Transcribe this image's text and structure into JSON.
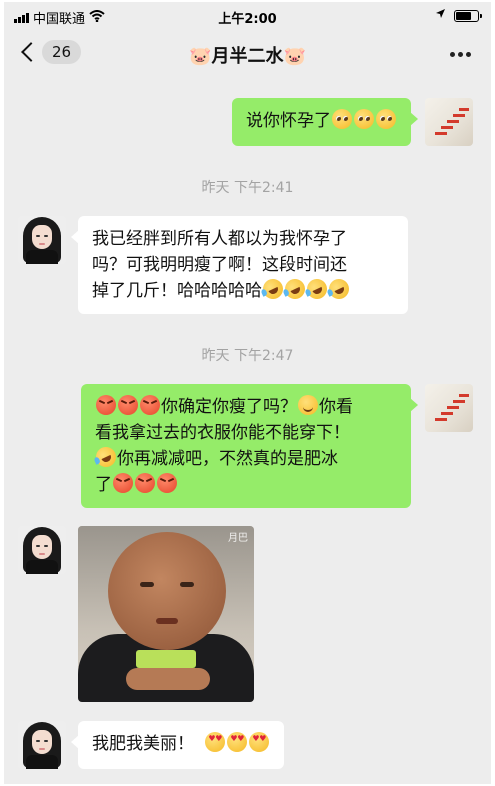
{
  "status_bar": {
    "carrier": "中国联通",
    "time": "上午2:00"
  },
  "nav": {
    "back_count": "26",
    "title": "🐷月半二水🐷"
  },
  "messages": [
    {
      "type": "outgoing",
      "text": "说你怀孕了",
      "emoji": [
        "pleading-face",
        "pleading-face",
        "pleading-face"
      ]
    },
    {
      "type": "timestamp",
      "text": "昨天 下午2:41"
    },
    {
      "type": "incoming",
      "lines": [
        "我已经胖到所有人都以为我怀孕了",
        "吗？可我明明瘦了啊！这段时间还",
        "掉了几斤！哈哈哈哈哈"
      ],
      "emoji": [
        "rolling-laughing",
        "rolling-laughing",
        "rolling-laughing",
        "rolling-laughing"
      ]
    },
    {
      "type": "timestamp",
      "text": "昨天 下午2:47"
    },
    {
      "type": "outgoing",
      "line1_emoji": [
        "angry-face",
        "angry-face",
        "angry-face"
      ],
      "line1_text": "你确定你瘦了吗？",
      "line1_emoji_b": "smiling-face",
      "line1_tail": "你看",
      "line2": "看我拿过去的衣服你能不能穿下！",
      "line3_emoji": "rolling-laughing",
      "line3_text": "你再减减吧，不然真的是肥冰",
      "line4_text": "了",
      "line4_emoji": [
        "angry-face",
        "angry-face",
        "angry-face"
      ]
    },
    {
      "type": "incoming-sticker",
      "watermark": "月巴"
    },
    {
      "type": "incoming",
      "text": "我肥我美丽！",
      "emoji": [
        "heart-eyes",
        "heart-eyes",
        "heart-eyes"
      ]
    }
  ]
}
